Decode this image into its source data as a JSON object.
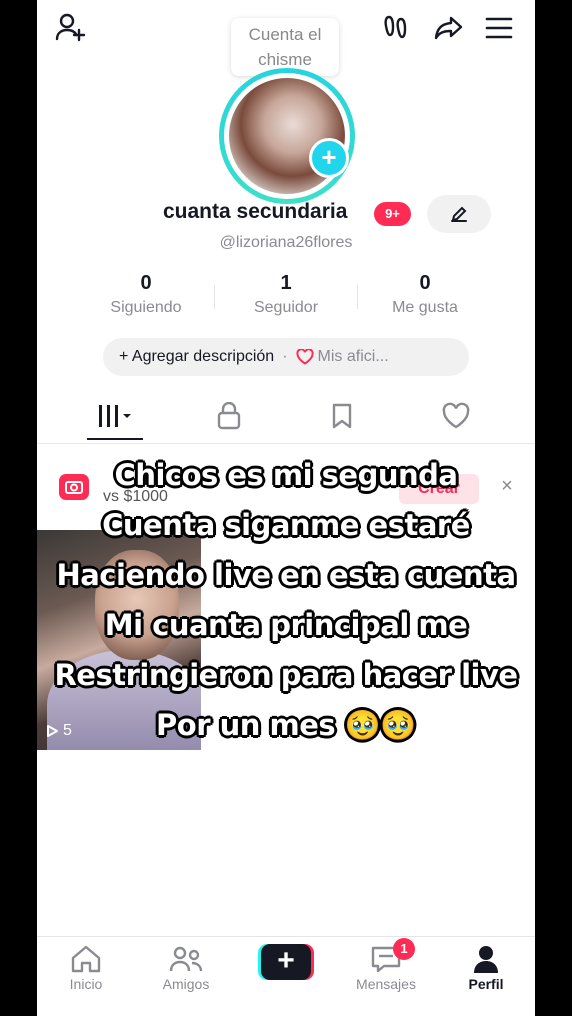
{
  "topbar": {
    "tooltip_line1": "Cuenta el",
    "tooltip_line2": "chisme"
  },
  "profile": {
    "username": "cuanta secundaria",
    "badge": "9+",
    "handle": "@lizoriana26flores"
  },
  "stats": [
    {
      "value": "0",
      "label": "Siguiendo"
    },
    {
      "value": "1",
      "label": "Seguidor"
    },
    {
      "value": "0",
      "label": "Me gusta"
    }
  ],
  "description": {
    "add_label": "+ Agregar descripción",
    "separator": "·",
    "hobbies_label": "Mis afici..."
  },
  "banner": {
    "text": "vs $1000",
    "create_label": "Crear",
    "close_label": "×"
  },
  "video": {
    "views": "5"
  },
  "overlay_caption": [
    "Chicos es mi segunda",
    "Cuenta siganme estaré",
    "Haciendo live en esta cuenta",
    "Mi cuanta principal me",
    "Restringieron para hacer live",
    "Por un mes 🥹🥹"
  ],
  "bottom_nav": {
    "home": "Inicio",
    "friends": "Amigos",
    "create": "+",
    "messages": "Mensajes",
    "messages_badge": "1",
    "profile": "Perfil"
  },
  "colors": {
    "accent": "#fe2c55",
    "ring": "#25d3e0",
    "text": "#161823",
    "muted": "#8a8b91"
  }
}
